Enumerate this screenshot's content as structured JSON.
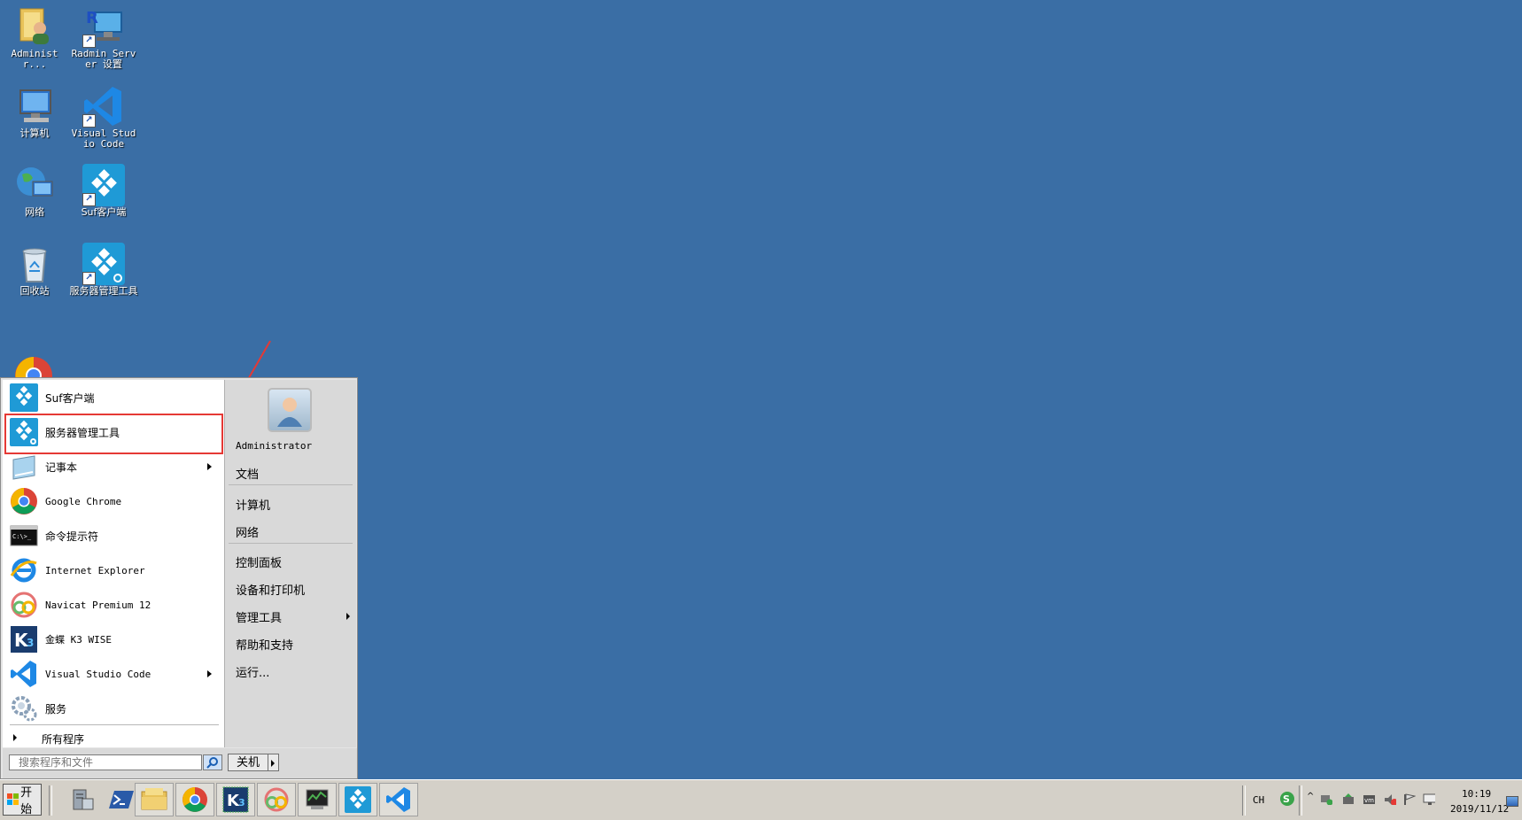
{
  "desktop": {
    "icons": {
      "admin": "Administr...",
      "radmin": "Radmin Server 设置",
      "computer": "计算机",
      "vscode": "Visual Studio Code",
      "network": "网络",
      "suf": "Suf客户端",
      "recycle": "回收站",
      "server_tool": "服务器管理工具"
    }
  },
  "start_menu": {
    "left_items": [
      {
        "label": "Suf客户端",
        "icon": "suf-icon"
      },
      {
        "label": "服务器管理工具",
        "icon": "server-tool-icon"
      },
      {
        "label": "记事本",
        "icon": "notepad-icon",
        "has_submenu": true
      },
      {
        "label": "Google Chrome",
        "icon": "chrome-icon"
      },
      {
        "label": "命令提示符",
        "icon": "cmd-icon"
      },
      {
        "label": "Internet Explorer",
        "icon": "ie-icon"
      },
      {
        "label": "Navicat Premium 12",
        "icon": "navicat-icon"
      },
      {
        "label": "金蝶 K3 WISE",
        "icon": "k3-icon"
      },
      {
        "label": "Visual Studio Code",
        "icon": "vscode-icon",
        "has_submenu": true
      },
      {
        "label": "服务",
        "icon": "services-icon"
      }
    ],
    "all_programs": "所有程序",
    "right_items": {
      "user": "Administrator",
      "documents": "文档",
      "computer": "计算机",
      "network": "网络",
      "control_panel": "控制面板",
      "devices": "设备和打印机",
      "admin_tools": "管理工具",
      "help": "帮助和支持",
      "run": "运行..."
    },
    "search_placeholder": "搜索程序和文件",
    "shutdown": "关机"
  },
  "taskbar": {
    "start": "开始",
    "lang": "CH",
    "time": "10:19",
    "date": "2019/11/12"
  },
  "colors": {
    "desktop": "#3a6ea5",
    "highlight": "#e53935",
    "suf_blue": "#1f9ad6"
  }
}
